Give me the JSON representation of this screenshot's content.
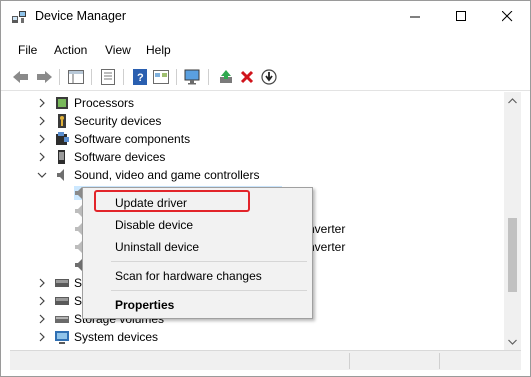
{
  "window": {
    "title": "Device Manager",
    "controls": [
      "minimize",
      "maximize",
      "close"
    ]
  },
  "menubar": {
    "items": [
      "File",
      "Action",
      "View",
      "Help"
    ]
  },
  "toolbar": {
    "buttons": [
      "back-icon",
      "forward-icon",
      "properties-pane-icon",
      "properties-sheet-icon",
      "help-icon",
      "show-hidden-icon",
      "monitor-icon",
      "update-driver-icon",
      "uninstall-icon",
      "download-icon"
    ]
  },
  "tree": {
    "rows": [
      {
        "label": "Processors",
        "expanded": false,
        "icon": "cpu-icon"
      },
      {
        "label": "Security devices",
        "expanded": false,
        "icon": "key-icon"
      },
      {
        "label": "Software components",
        "expanded": false,
        "icon": "puzzle-icon"
      },
      {
        "label": "Software devices",
        "expanded": false,
        "icon": "device-icon"
      },
      {
        "label": "Sound, video and game controllers",
        "expanded": true,
        "icon": "speaker-icon"
      },
      {
        "label": "",
        "child": true,
        "icon": "speaker-icon"
      },
      {
        "label": "",
        "child": true,
        "icon": "speaker-icon"
      },
      {
        "label": "nverter",
        "child": true,
        "icon": "speaker-icon"
      },
      {
        "label": "nverter",
        "child": true,
        "icon": "speaker-icon"
      },
      {
        "label": "",
        "child": true,
        "icon": "speaker-icon"
      },
      {
        "label": "S",
        "expanded": false,
        "icon": "storage-icon"
      },
      {
        "label": "S",
        "expanded": false,
        "icon": "storage-icon"
      },
      {
        "label": "Storage volumes",
        "expanded": false,
        "icon": "volume-icon"
      },
      {
        "label": "System devices",
        "expanded": false,
        "icon": "system-icon"
      }
    ]
  },
  "context_menu": {
    "items": [
      {
        "label": "Update driver",
        "highlighted": true
      },
      {
        "label": "Disable device"
      },
      {
        "label": "Uninstall device"
      },
      {
        "label": "Scan for hardware changes"
      },
      {
        "label": "Properties",
        "bold": true
      }
    ]
  },
  "colors": {
    "highlight_border": "#e2242a",
    "selection": "#cce8ff",
    "menu_bg": "#f2f2f2"
  }
}
